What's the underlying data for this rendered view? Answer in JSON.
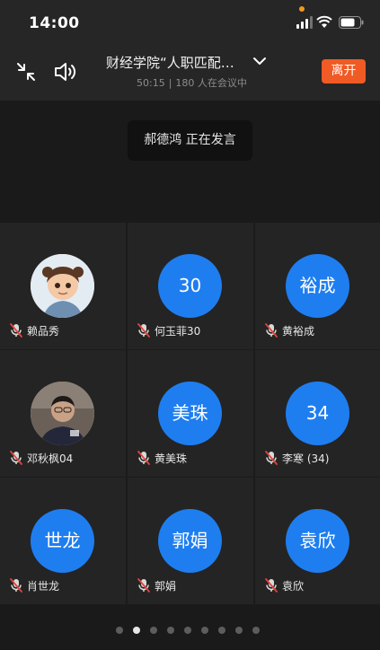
{
  "status_bar": {
    "time": "14:00"
  },
  "header": {
    "title": "财经学院“人职匹配…",
    "duration": "50:15",
    "separator": "|",
    "attendees": "180 人在会议中",
    "leave_label": "离开"
  },
  "speaking": {
    "text": "郝德鸿 正在发言"
  },
  "participants": [
    {
      "name": "赖品秀",
      "avatar_text": "",
      "photo": true
    },
    {
      "name": "何玉菲30",
      "avatar_text": "30",
      "photo": false
    },
    {
      "name": "黄裕成",
      "avatar_text": "裕成",
      "photo": false
    },
    {
      "name": "邓秋枫04",
      "avatar_text": "",
      "photo": true
    },
    {
      "name": "黄美珠",
      "avatar_text": "美珠",
      "photo": false
    },
    {
      "name": "李寒 (34)",
      "avatar_text": "34",
      "photo": false
    },
    {
      "name": "肖世龙",
      "avatar_text": "世龙",
      "photo": false
    },
    {
      "name": "郭娟",
      "avatar_text": "郭娟",
      "photo": false
    },
    {
      "name": "袁欣",
      "avatar_text": "袁欣",
      "photo": false
    }
  ],
  "pagination": {
    "total_pages": 9,
    "current_page": 2
  },
  "colors": {
    "accent_blue": "#1e7ef0",
    "leave_orange": "#f05a24",
    "mic_red": "#e0453a"
  }
}
